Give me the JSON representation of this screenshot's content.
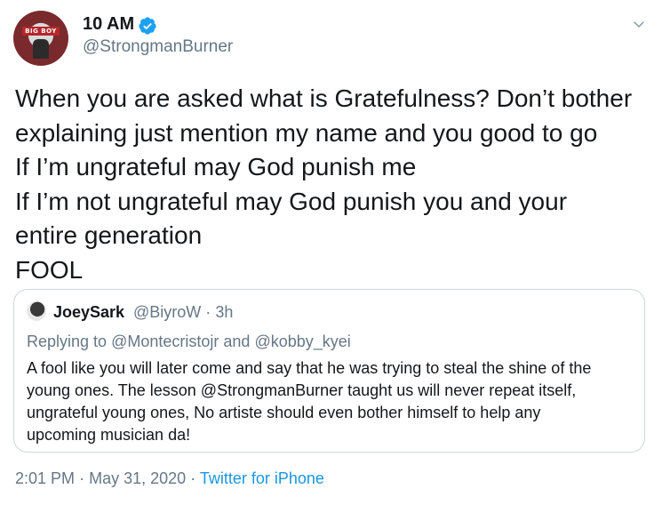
{
  "author": {
    "display_name": "10 AM",
    "handle": "@StrongmanBurner",
    "avatar_text": "BIG BOY",
    "verified_color": "#1da1f2"
  },
  "tweet": {
    "lines": [
      "When you are asked what is Gratefulness? Don’t bother",
      "explaining just mention my name and you good to go",
      "If I’m ungrateful may God punish me",
      "If I’m not ungrateful may God punish you and your",
      "entire generation",
      "FOOL"
    ]
  },
  "quoted": {
    "name": "JoeySark",
    "handle": "@BiyroW",
    "separator": "·",
    "time": "3h",
    "replying_prefix": "Replying to",
    "replying_user1": "@Montecristojr",
    "replying_and": "and",
    "replying_user2": "@kobby_kyei",
    "lines": [
      "A fool like you will later come and say that he was trying to steal the shine of the",
      "young ones. The lesson @StrongmanBurner taught us will never repeat itself,",
      "ungrateful young ones, No artiste should even bother himself to help any",
      "upcoming musician da!"
    ]
  },
  "footer": {
    "time": "2:01 PM",
    "dot1": "·",
    "date": "May 31, 2020",
    "dot2": "·",
    "source": "Twitter for iPhone"
  },
  "colors": {
    "text": "#14171a",
    "secondary": "#657786",
    "link": "#1b95e0",
    "border": "#ccd6dd"
  },
  "icons": {
    "verified": "verified-badge-icon",
    "caret": "chevron-down-icon"
  }
}
